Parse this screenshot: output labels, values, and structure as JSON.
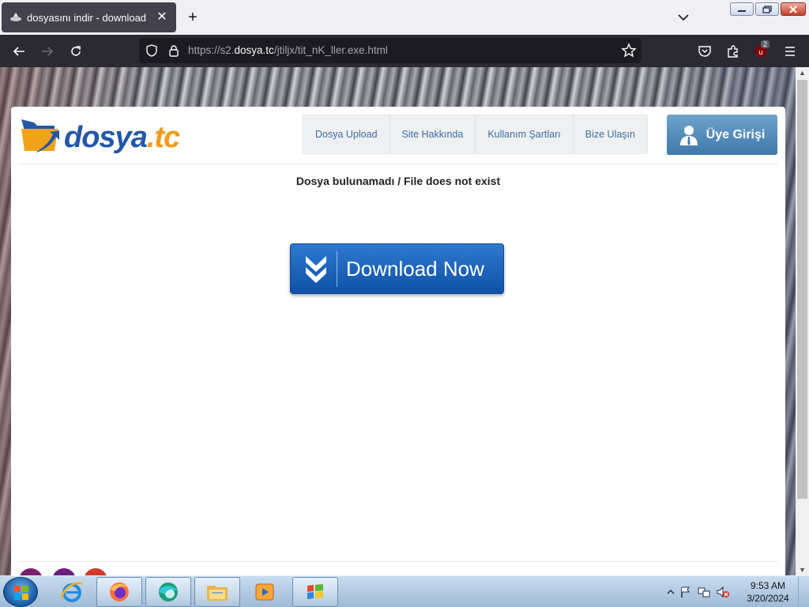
{
  "browser": {
    "tab_title": "dosyasını indir - download",
    "url_prefix": "https://s2.",
    "url_domain": "dosya.tc",
    "url_path": "/jtiljx/tit_nK_ller.exe.html",
    "extension_badge": "2",
    "tab_close_glyph": "✕",
    "new_tab_glyph": "+"
  },
  "site": {
    "logo_main": "dosya",
    "logo_accent": ".tc",
    "menu": [
      {
        "label": "Dosya Upload"
      },
      {
        "label": "Site Hakkında"
      },
      {
        "label": "Kullanım Şartları"
      },
      {
        "label": "Bize Ulaşın"
      }
    ],
    "login_label": "Üye Girişi",
    "notice": "Dosya bulunamadı / File does not exist",
    "download_label": "Download Now",
    "colors": {
      "brand_blue": "#2357a8",
      "brand_orange": "#f29a1c",
      "button_blue": "#0e52a6"
    }
  },
  "taskbar": {
    "time": "9:53 AM",
    "date": "3/20/2024",
    "apps": [
      "internet-explorer-icon",
      "firefox-icon",
      "edge-icon",
      "file-explorer-icon",
      "media-player-icon",
      "windows-flag-icon"
    ]
  }
}
